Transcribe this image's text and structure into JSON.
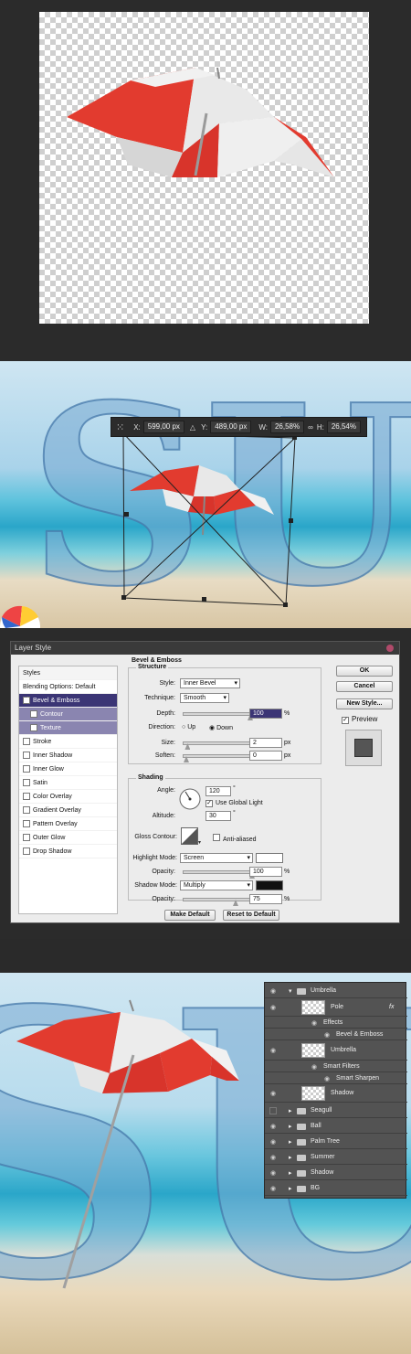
{
  "transform": {
    "x_label": "X:",
    "x": "599,00 px",
    "y_label": "Y:",
    "y": "489,00 px",
    "w_label": "W:",
    "w": "26,58%",
    "h_label": "H:",
    "h": "26,54%"
  },
  "dialog": {
    "title": "Layer Style",
    "styles_header": "Styles",
    "styles": [
      {
        "label": "Blending Options: Default",
        "checkbox": false,
        "state": "normal"
      },
      {
        "label": "Bevel & Emboss",
        "checkbox": true,
        "checked": true,
        "state": "selected"
      },
      {
        "label": "Contour",
        "checkbox": true,
        "checked": false,
        "state": "sub"
      },
      {
        "label": "Texture",
        "checkbox": true,
        "checked": false,
        "state": "sub"
      },
      {
        "label": "Stroke",
        "checkbox": true,
        "checked": false,
        "state": "normal"
      },
      {
        "label": "Inner Shadow",
        "checkbox": true,
        "checked": false,
        "state": "normal"
      },
      {
        "label": "Inner Glow",
        "checkbox": true,
        "checked": false,
        "state": "normal"
      },
      {
        "label": "Satin",
        "checkbox": true,
        "checked": false,
        "state": "normal"
      },
      {
        "label": "Color Overlay",
        "checkbox": true,
        "checked": false,
        "state": "normal"
      },
      {
        "label": "Gradient Overlay",
        "checkbox": true,
        "checked": false,
        "state": "normal"
      },
      {
        "label": "Pattern Overlay",
        "checkbox": true,
        "checked": false,
        "state": "normal"
      },
      {
        "label": "Outer Glow",
        "checkbox": true,
        "checked": false,
        "state": "normal"
      },
      {
        "label": "Drop Shadow",
        "checkbox": true,
        "checked": false,
        "state": "normal"
      }
    ],
    "section_title": "Bevel & Emboss",
    "structure": {
      "title": "Structure",
      "style_label": "Style:",
      "style": "Inner Bevel",
      "technique_label": "Technique:",
      "technique": "Smooth",
      "depth_label": "Depth:",
      "depth": "100",
      "depth_unit": "%",
      "depth_level": 1.0,
      "direction_label": "Direction:",
      "up": "Up",
      "down": "Down",
      "direction": "Down",
      "size_label": "Size:",
      "size": "2",
      "size_unit": "px",
      "size_level": 0.02,
      "soften_label": "Soften:",
      "soften": "0",
      "soften_unit": "px",
      "soften_level": 0.0
    },
    "shading": {
      "title": "Shading",
      "angle_label": "Angle:",
      "angle": "120",
      "deg": "°",
      "use_global": "Use Global Light",
      "use_global_checked": true,
      "altitude_label": "Altitude:",
      "altitude": "30",
      "gloss_label": "Gloss Contour:",
      "anti_aliased": "Anti-aliased",
      "highlight_label": "Highlight Mode:",
      "highlight_mode": "Screen",
      "highlight_color": "#ffffff",
      "opacity_label": "Opacity:",
      "hl_opacity": "100",
      "shadow_label": "Shadow Mode:",
      "shadow_mode": "Multiply",
      "shadow_color": "#111111",
      "sh_opacity": "75",
      "pct": "%"
    },
    "buttons": {
      "make_default": "Make Default",
      "reset_default": "Reset to Default",
      "ok": "OK",
      "cancel": "Cancel",
      "new_style": "New Style...",
      "preview": "Preview",
      "preview_checked": true
    }
  },
  "layers": [
    {
      "name": "Umbrella",
      "kind": "group-open"
    },
    {
      "name": "Pole",
      "kind": "layer",
      "fx": "fx"
    },
    {
      "name": "Effects",
      "kind": "effect"
    },
    {
      "name": "Bevel & Emboss",
      "kind": "effect-item"
    },
    {
      "name": "Umbrella",
      "kind": "smart"
    },
    {
      "name": "Smart Filters",
      "kind": "effect"
    },
    {
      "name": "Smart Sharpen",
      "kind": "effect-item"
    },
    {
      "name": "Shadow",
      "kind": "layer"
    },
    {
      "name": "Seagull",
      "kind": "group",
      "hidden": true
    },
    {
      "name": "Ball",
      "kind": "group"
    },
    {
      "name": "Palm Tree",
      "kind": "group"
    },
    {
      "name": "Summer",
      "kind": "group"
    },
    {
      "name": "Shadow",
      "kind": "group"
    },
    {
      "name": "BG",
      "kind": "group"
    }
  ],
  "icons": [
    "eye-icon",
    "folder-icon",
    "fx-icon",
    "dialog-close-icon"
  ]
}
